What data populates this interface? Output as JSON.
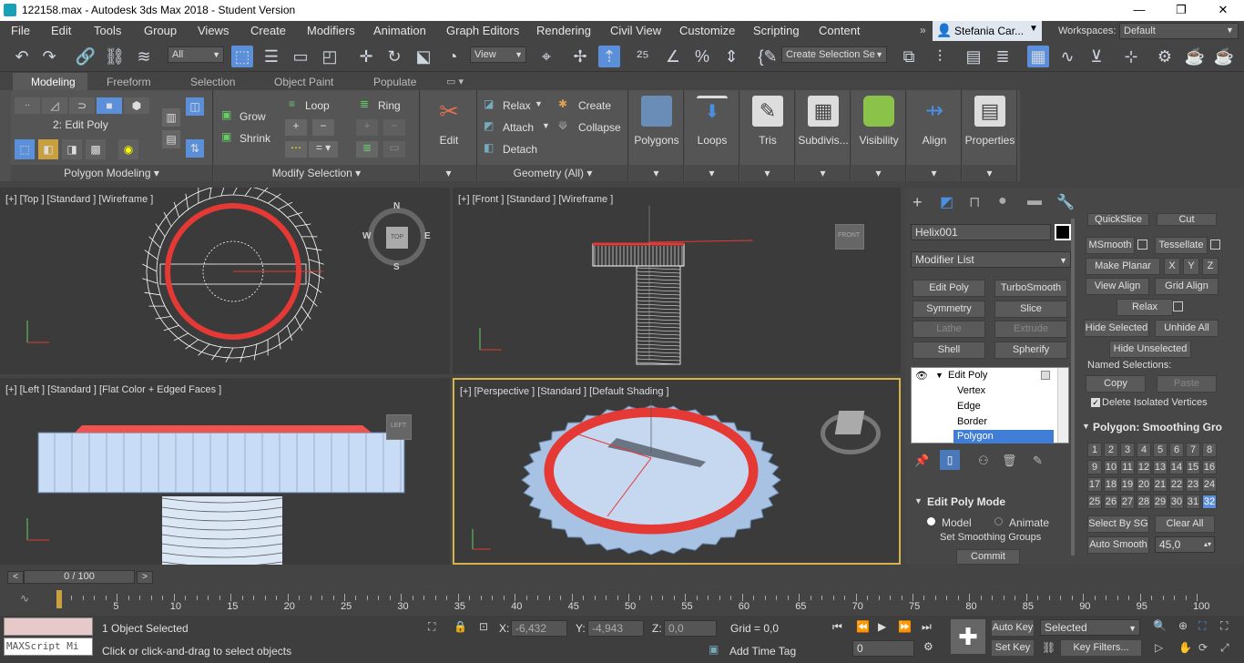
{
  "window": {
    "title": "122158.max - Autodesk 3ds Max 2018 - Student Version",
    "minimize": "—",
    "restore": "❐",
    "close": "✕"
  },
  "menu": [
    "File",
    "Edit",
    "Tools",
    "Group",
    "Views",
    "Create",
    "Modifiers",
    "Animation",
    "Graph Editors",
    "Rendering",
    "Civil View",
    "Customize",
    "Scripting",
    "Content"
  ],
  "user": {
    "name": "Stefania Car...",
    "workspaces_label": "Workspaces:",
    "workspace": "Default"
  },
  "toolbar": {
    "selection_filter": "All",
    "view_label": "View",
    "create_selection_set": "Create Selection Se"
  },
  "ribbon_tabs": [
    "Modeling",
    "Freeform",
    "Selection",
    "Object Paint",
    "Populate"
  ],
  "ribbon": {
    "mode_label": "2: Edit Poly",
    "poly_modeling": "Polygon Modeling",
    "grow": "Grow",
    "shrink": "Shrink",
    "loop": "Loop",
    "ring": "Ring",
    "modify_selection": "Modify Selection",
    "edit": "Edit",
    "relax": "Relax",
    "create": "Create",
    "attach": "Attach",
    "collapse": "Collapse",
    "detach": "Detach",
    "geometry_all": "Geometry (All)",
    "big_buttons": [
      "Polygons",
      "Loops",
      "Tris",
      "Subdivis...",
      "Visibility",
      "Align",
      "Properties"
    ]
  },
  "viewports": {
    "top": "[+] [Top ] [Standard ] [Wireframe ]",
    "front": "[+] [Front ] [Standard ] [Wireframe ]",
    "left": "[+] [Left ] [Standard ] [Flat Color + Edged Faces ]",
    "perspective": "[+] [Perspective ] [Standard ] [Default Shading ]",
    "cube_top": "TOP",
    "cube_front": "FRONT",
    "cube_left": "LEFT",
    "compass": [
      "N",
      "E",
      "S",
      "W"
    ]
  },
  "command_panel": {
    "object_name": "Helix001",
    "modifier_list": "Modifier List",
    "modifiers": [
      "Edit Poly",
      "TurboSmooth",
      "Symmetry",
      "Slice",
      "Lathe",
      "Extrude",
      "Shell",
      "Spherify"
    ],
    "stack": {
      "root": "Edit Poly",
      "children": [
        "Vertex",
        "Edge",
        "Border",
        "Polygon"
      ]
    },
    "edit_poly_mode": "Edit Poly Mode",
    "model": "Model",
    "animate": "Animate",
    "set_smoothing_groups": "Set Smoothing Groups",
    "commit": "Commit",
    "right": {
      "quickslice": "QuickSlice",
      "cut": "Cut",
      "msmooth": "MSmooth",
      "tessellate": "Tessellate",
      "make_planar": "Make Planar",
      "x": "X",
      "y": "Y",
      "z": "Z",
      "view_align": "View Align",
      "grid_align": "Grid Align",
      "relax": "Relax",
      "hide_selected": "Hide Selected",
      "unhide_all": "Unhide All",
      "hide_unselected": "Hide Unselected",
      "named_selections": "Named Selections:",
      "copy": "Copy",
      "paste": "Paste",
      "delete_isolated": "Delete Isolated Vertices",
      "smoothing_title": "Polygon: Smoothing Gro",
      "groups": [
        "1",
        "2",
        "3",
        "4",
        "5",
        "6",
        "7",
        "8",
        "9",
        "10",
        "11",
        "12",
        "13",
        "14",
        "15",
        "16",
        "17",
        "18",
        "19",
        "20",
        "21",
        "22",
        "23",
        "24",
        "25",
        "26",
        "27",
        "28",
        "29",
        "30",
        "31",
        "32"
      ],
      "select_by_sg": "Select By SG",
      "clear_all": "Clear All",
      "auto_smooth": "Auto Smooth",
      "auto_smooth_value": "45,0"
    }
  },
  "timeline": {
    "frame": "0 / 100",
    "ticks": [
      "0",
      "5",
      "10",
      "15",
      "20",
      "25",
      "30",
      "35",
      "40",
      "45",
      "50",
      "55",
      "60",
      "65",
      "70",
      "75",
      "80",
      "85",
      "90",
      "95",
      "100"
    ]
  },
  "status": {
    "maxscript": "MAXScript Mi",
    "selected": "1 Object Selected",
    "prompt": "Click or click-and-drag to select objects",
    "x_label": "X:",
    "x_value": "-6,432",
    "y_label": "Y:",
    "y_value": "-4,943",
    "z_label": "Z:",
    "z_value": "0,0",
    "grid": "Grid = 0,0",
    "add_time_tag": "Add Time Tag",
    "auto_key": "Auto Key",
    "set_key": "Set Key",
    "key_mode": "Selected",
    "key_filters": "Key Filters...",
    "current_frame": "0"
  }
}
